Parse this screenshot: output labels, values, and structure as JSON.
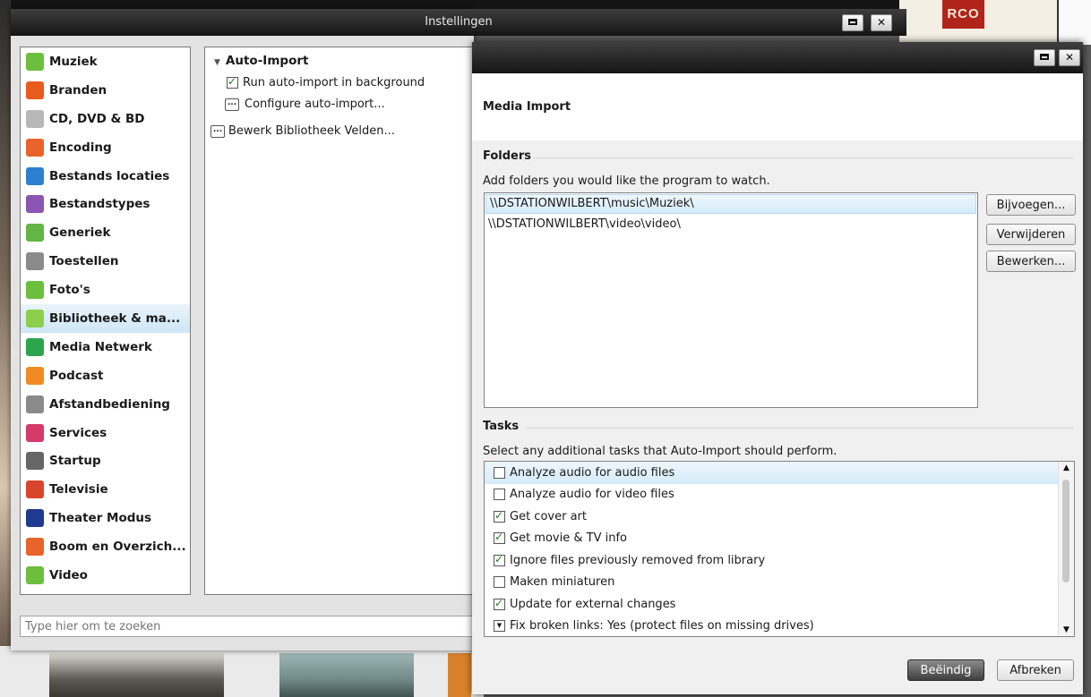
{
  "background": {
    "logo_text": "RCO"
  },
  "main_window": {
    "title": "Instellingen",
    "nav_items": [
      {
        "label": "Muziek",
        "icon": "music-folder-icon",
        "color": "#6cbf3c"
      },
      {
        "label": "Branden",
        "icon": "burn-icon",
        "color": "#e85a1e"
      },
      {
        "label": "CD, DVD & BD",
        "icon": "disc-icon",
        "color": "#b8b8b8"
      },
      {
        "label": "Encoding",
        "icon": "encoding-icon",
        "color": "#e8642c"
      },
      {
        "label": "Bestands locaties",
        "icon": "file-locations-icon",
        "color": "#2f7fd0"
      },
      {
        "label": "Bestandstypes",
        "icon": "file-types-icon",
        "color": "#8a55b3"
      },
      {
        "label": "Generiek",
        "icon": "general-icon",
        "color": "#63b544"
      },
      {
        "label": "Toestellen",
        "icon": "device-icon",
        "color": "#8a8a8a"
      },
      {
        "label": "Foto's",
        "icon": "photos-icon",
        "color": "#6cbf3c"
      },
      {
        "label": "Bibliotheek & ma...",
        "icon": "library-icon",
        "color": "#8ccf4c"
      },
      {
        "label": "Media Netwerk",
        "icon": "media-network-icon",
        "color": "#2ea44f"
      },
      {
        "label": "Podcast",
        "icon": "podcast-icon",
        "color": "#f08a24"
      },
      {
        "label": "Afstandbediening",
        "icon": "remote-control-icon",
        "color": "#8a8a8a"
      },
      {
        "label": "Services",
        "icon": "services-icon",
        "color": "#d43a6a"
      },
      {
        "label": "Startup",
        "icon": "startup-icon",
        "color": "#666666"
      },
      {
        "label": "Televisie",
        "icon": "television-icon",
        "color": "#d8452b"
      },
      {
        "label": "Theater Modus",
        "icon": "theater-icon",
        "color": "#1f3b8f"
      },
      {
        "label": "Boom en Overzich...",
        "icon": "tree-view-icon",
        "color": "#e8642c"
      },
      {
        "label": "Video",
        "icon": "video-folder-icon",
        "color": "#6cbf3c"
      }
    ],
    "selected_nav_index": 9,
    "panel": {
      "section_title": "Auto-Import",
      "run_in_background_label": "Run auto-import in background",
      "run_in_background_checked": true,
      "configure_label": "Configure auto-import...",
      "edit_fields_label": "Bewerk Bibliotheek Velden..."
    },
    "search": {
      "placeholder": "Type hier om te zoeken"
    }
  },
  "dialog": {
    "heading": "Media Import",
    "folders": {
      "section_title": "Folders",
      "hint": "Add folders you would like the program to watch.",
      "items": [
        "\\\\DSTATIONWILBERT\\music\\Muziek\\",
        "\\\\DSTATIONWILBERT\\video\\video\\"
      ],
      "add_label": "Bijvoegen...",
      "remove_label": "Verwijderen",
      "edit_label": "Bewerken..."
    },
    "tasks": {
      "section_title": "Tasks",
      "hint": "Select any additional tasks that Auto-Import should perform.",
      "items": [
        {
          "label": "Analyze audio for audio files",
          "checked": false,
          "type": "checkbox"
        },
        {
          "label": "Analyze audio for video files",
          "checked": false,
          "type": "checkbox"
        },
        {
          "label": "Get cover art",
          "checked": true,
          "type": "checkbox"
        },
        {
          "label": "Get movie & TV info",
          "checked": true,
          "type": "checkbox"
        },
        {
          "label": "Ignore files previously removed from library",
          "checked": true,
          "type": "checkbox"
        },
        {
          "label": "Maken miniaturen",
          "checked": false,
          "type": "checkbox"
        },
        {
          "label": "Update for external changes",
          "checked": true,
          "type": "checkbox"
        },
        {
          "label": "Fix broken links: Yes (protect files on missing drives)",
          "checked": false,
          "type": "dropdown"
        }
      ]
    },
    "finish_label": "Beëindig",
    "cancel_label": "Afbreken"
  }
}
